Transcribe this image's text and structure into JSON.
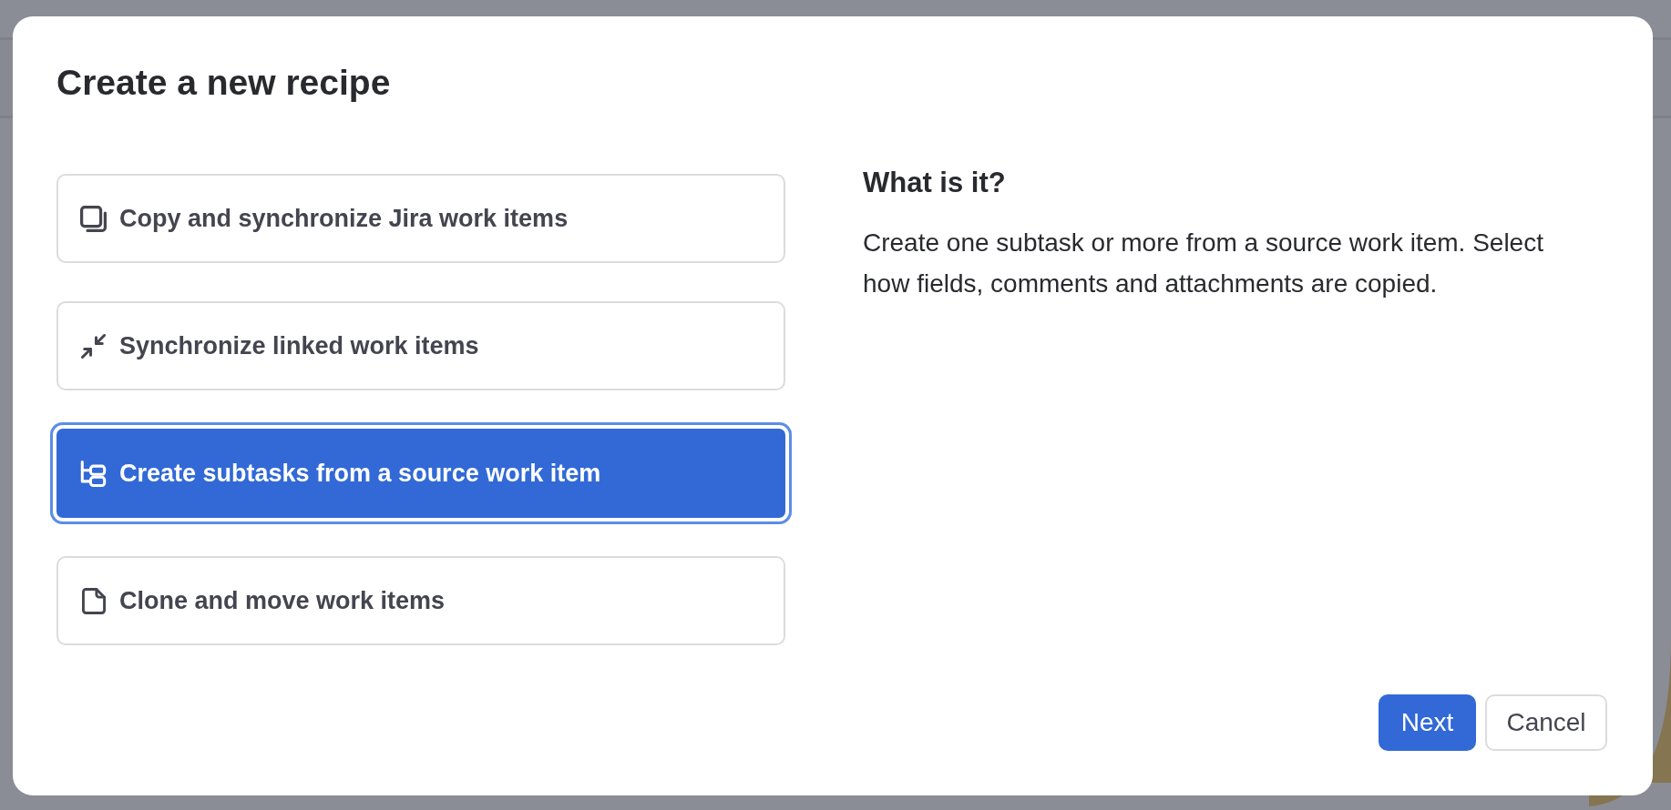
{
  "dialog": {
    "title": "Create a new recipe",
    "options": [
      {
        "kind": "copy",
        "label": "Copy and synchronize Jira work items",
        "selected": false
      },
      {
        "kind": "sync",
        "label": "Synchronize linked work items",
        "selected": false
      },
      {
        "kind": "subtasks",
        "label": "Create subtasks from a source work item",
        "selected": true
      },
      {
        "kind": "clone",
        "label": "Clone and move work items",
        "selected": false
      }
    ],
    "details": {
      "heading": "What is it?",
      "description": "Create one subtask or more from a source work item. Select how fields, comments and attachments are copied."
    },
    "buttons": [
      {
        "kind": "primary",
        "label": "Next"
      },
      {
        "kind": "secondary",
        "label": "Cancel"
      }
    ]
  }
}
